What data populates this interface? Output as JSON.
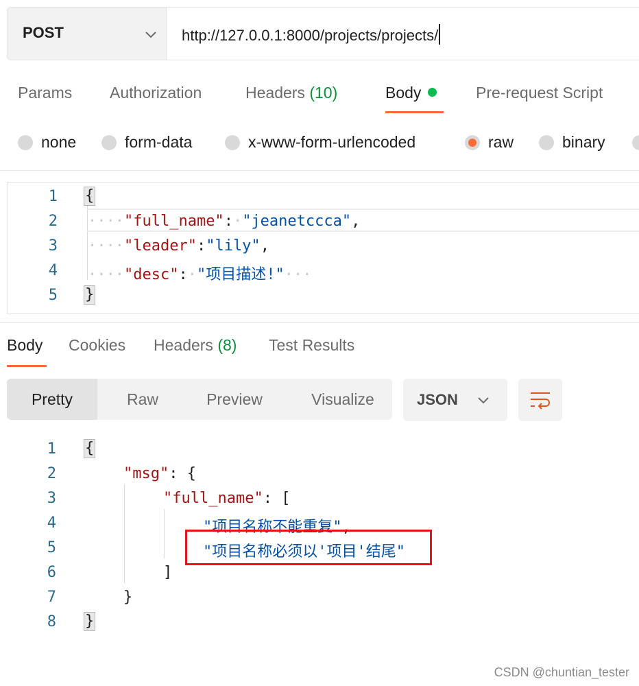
{
  "request": {
    "method": "POST",
    "url": "http://127.0.0.1:8000/projects/projects/"
  },
  "request_tabs": {
    "params": "Params",
    "authorization": "Authorization",
    "headers": "Headers",
    "headers_count": "(10)",
    "body": "Body",
    "prerequest": "Pre-request Script"
  },
  "body_modes": [
    "none",
    "form-data",
    "x-www-form-urlencoded",
    "raw",
    "binary"
  ],
  "body_mode_selected": "raw",
  "request_body": {
    "line_numbers": [
      "1",
      "2",
      "3",
      "4",
      "5"
    ],
    "open_brace": "{",
    "close_brace": "}",
    "fields": [
      {
        "key": "\"full_name\"",
        "value": "\"jeanetccca\""
      },
      {
        "key": "\"leader\"",
        "value": "\"lily\""
      },
      {
        "key": "\"desc\"",
        "value": "\"项目描述!\""
      }
    ]
  },
  "response_tabs": {
    "body": "Body",
    "cookies": "Cookies",
    "headers": "Headers",
    "headers_count": "(8)",
    "test_results": "Test Results"
  },
  "view_modes": [
    "Pretty",
    "Raw",
    "Preview",
    "Visualize"
  ],
  "format": "JSON",
  "response_body": {
    "line_numbers": [
      "1",
      "2",
      "3",
      "4",
      "5",
      "6",
      "7",
      "8"
    ],
    "open_brace": "{",
    "msg_key": "\"msg\"",
    "full_name_key": "\"full_name\"",
    "open_bracket": "[",
    "errors": [
      "\"项目名称不能重复\"",
      "\"项目名称必须以'项目'结尾\""
    ],
    "close_bracket": "]",
    "inner_close": "}",
    "close_brace": "}"
  },
  "watermark": "CSDN @chuntian_tester",
  "colors": {
    "accent": "#ff6c37",
    "count_green": "#0c8f3a",
    "highlight": "#e3131e"
  }
}
